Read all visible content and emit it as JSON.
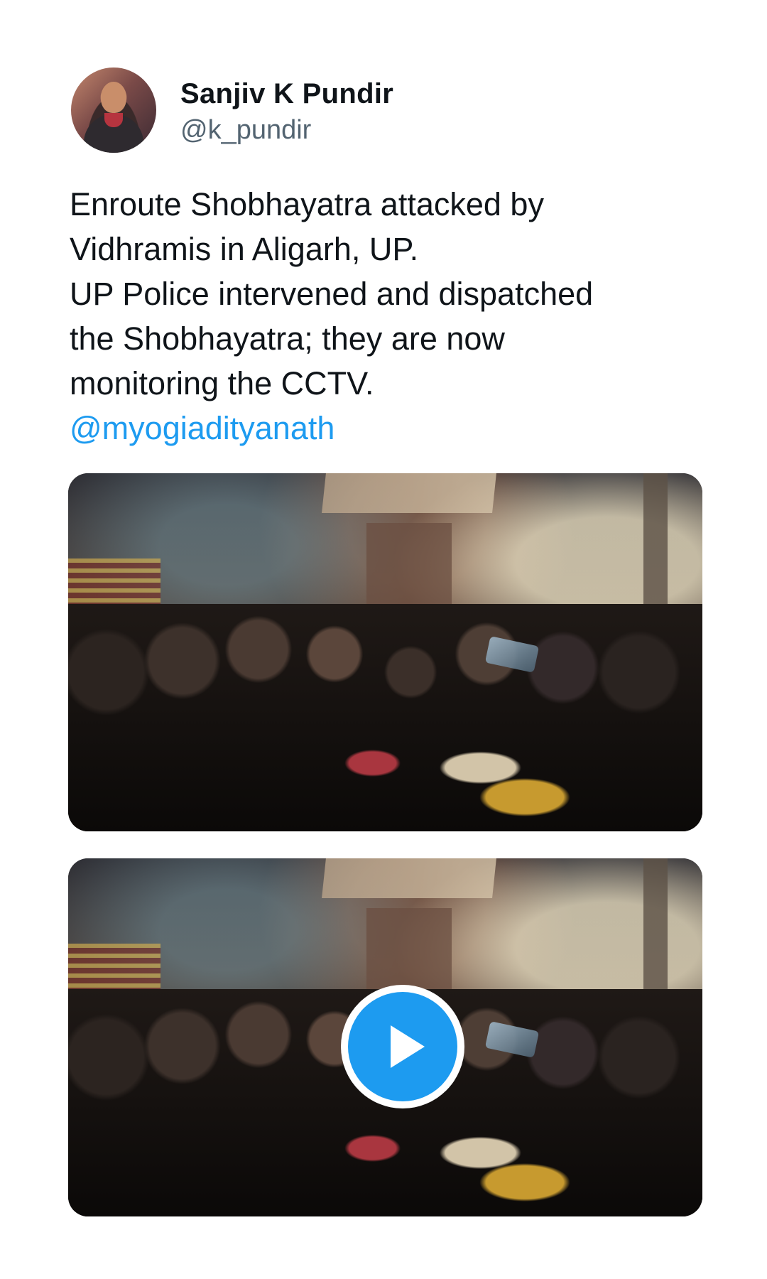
{
  "author": {
    "display_name": "Sanjiv K Pundir",
    "handle": "@k_pundir"
  },
  "tweet": {
    "lines": [
      "Enroute Shobhayatra attacked by",
      "Vidhramis in Aligarh, UP.",
      "UP Police intervened and dispatched",
      "the Shobhayatra; they are now",
      "monitoring the CCTV."
    ],
    "mention": "@myogiadityanath"
  },
  "media": [
    {
      "kind": "photo"
    },
    {
      "kind": "video",
      "icon": "play-icon"
    }
  ],
  "colors": {
    "accent": "#1d9bf0",
    "secondary_text": "#536471",
    "primary_text": "#0f1419"
  }
}
